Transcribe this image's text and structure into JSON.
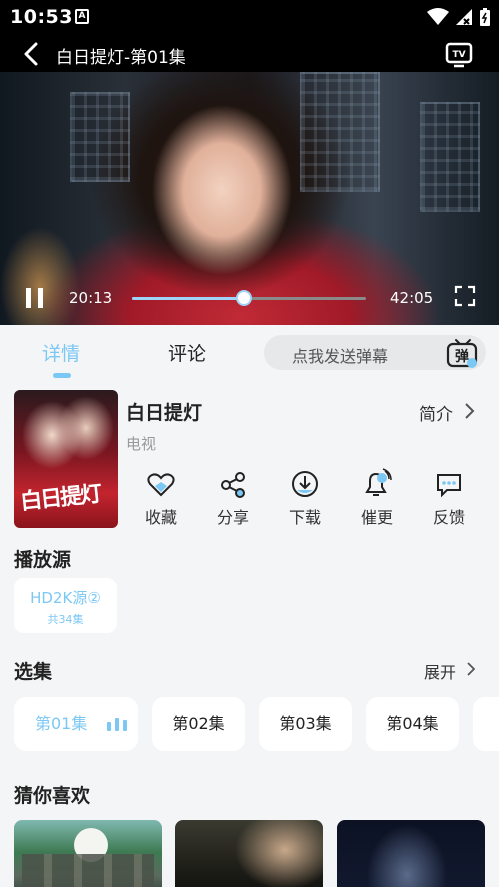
{
  "status_bar": {
    "time": "10:53",
    "notification_icon": "A"
  },
  "player": {
    "title": "白日提灯-第01集",
    "current_time": "20:13",
    "total_time": "42:05",
    "progress": 0.48
  },
  "tabs": [
    {
      "label": "详情",
      "active": true
    },
    {
      "label": "评论",
      "active": false
    }
  ],
  "danmaku": {
    "placeholder": "点我发送弹幕",
    "icon_text": "弹"
  },
  "show": {
    "title": "白日提灯",
    "type": "电视",
    "intro_label": "简介",
    "poster_text": "白日提灯"
  },
  "actions": [
    {
      "label": "收藏",
      "icon": "heart-icon"
    },
    {
      "label": "分享",
      "icon": "share-icon"
    },
    {
      "label": "下载",
      "icon": "download-icon"
    },
    {
      "label": "催更",
      "icon": "bell-icon"
    },
    {
      "label": "反馈",
      "icon": "feedback-icon"
    }
  ],
  "source": {
    "heading": "播放源",
    "name": "HD2K源②",
    "count": "共34集"
  },
  "episodes": {
    "heading": "选集",
    "expand_label": "展开",
    "items": [
      {
        "label": "第01集",
        "active": true
      },
      {
        "label": "第02集",
        "active": false
      },
      {
        "label": "第03集",
        "active": false
      },
      {
        "label": "第04集",
        "active": false
      }
    ]
  },
  "recommend": {
    "heading": "猜你喜欢"
  },
  "colors": {
    "accent": "#7cc8f4",
    "background": "#f4f5f7"
  }
}
